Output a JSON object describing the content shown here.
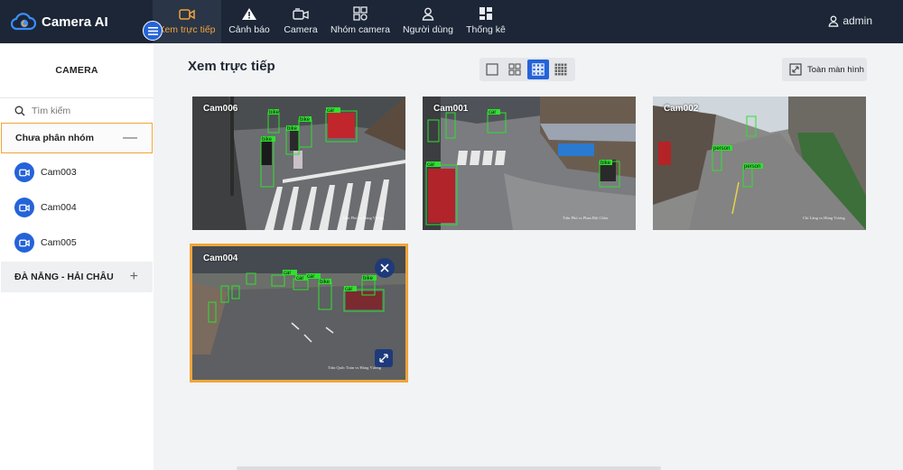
{
  "app": {
    "name": "Camera AI"
  },
  "nav": {
    "items": [
      {
        "label": "Xem trực tiếp",
        "icon": "video-camera-icon"
      },
      {
        "label": "Cảnh báo",
        "icon": "warning-icon"
      },
      {
        "label": "Camera",
        "icon": "camera-icon"
      },
      {
        "label": "Nhóm camera",
        "icon": "grid-group-icon"
      },
      {
        "label": "Người dùng",
        "icon": "user-icon"
      },
      {
        "label": "Thống kê",
        "icon": "stats-icon"
      }
    ],
    "user": "admin"
  },
  "sidebar": {
    "title": "CAMERA",
    "search_placeholder": "Tìm kiếm",
    "groups": [
      {
        "name": "Chưa phân nhóm",
        "toggle": "—",
        "cameras": [
          "Cam003",
          "Cam004",
          "Cam005"
        ]
      },
      {
        "name": "ĐÀ NẴNG - HẢI CHÂU",
        "toggle": "+"
      }
    ]
  },
  "main": {
    "title": "Xem trực tiếp",
    "fullscreen_label": "Toàn màn hình",
    "layout_options": [
      "1x1",
      "2x2",
      "3x3",
      "4x4"
    ],
    "active_layout": "3x3"
  },
  "tiles": [
    {
      "name": "Cam006",
      "street": "Trần Phú vs Hùng Vương",
      "labels": [
        "bike",
        "car",
        "bike",
        "bike",
        "bike"
      ]
    },
    {
      "name": "Cam001",
      "street": "Trần Phú vs Phan Bội Châu",
      "labels": [
        "car",
        "car",
        "bike"
      ]
    },
    {
      "name": "Cam002",
      "street": "Chi Lăng vs Hùng Vương",
      "labels": [
        "person",
        "person"
      ]
    },
    {
      "name": "Cam004",
      "street": "Trần Quốc Toản vs Hùng Vương",
      "labels": [
        "bike",
        "car",
        "car",
        "car",
        "car",
        "bike"
      ],
      "selected": true
    }
  ],
  "colors": {
    "accent": "#f0a43a",
    "primary": "#2563d9",
    "nav_bg": "#1c2636",
    "detection": "#2fe02f"
  }
}
